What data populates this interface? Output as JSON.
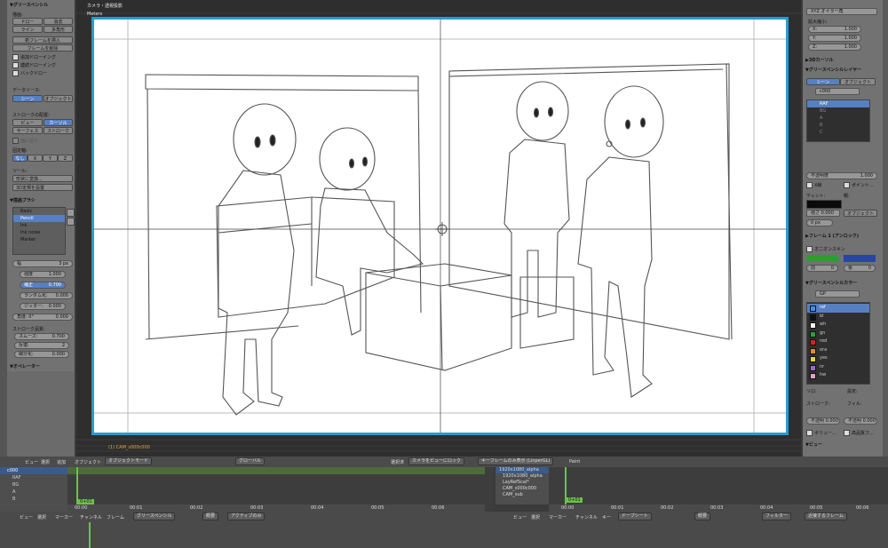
{
  "left_panel": {
    "title": "▼グリースペンシル",
    "draw_label": "描画:",
    "draw_buttons": [
      "ドロー",
      "消去",
      "ライン",
      "多角形"
    ],
    "actions": [
      "新フレームを挿入",
      "フレームを削除"
    ],
    "checks": [
      "追加ドローイング",
      "連続ドローイング",
      "バックドロー"
    ],
    "datasource_label": "データソース:",
    "datasource_buttons": [
      "シーン",
      "オブジェクト"
    ],
    "stroke_placement_label": "ストロークの配置:",
    "placement_buttons": [
      "ビュー",
      "カーソル",
      "サーフェス",
      "ストローク"
    ],
    "plane_label": "面に沿う",
    "lock_axis_label": "固定軸:",
    "axis_buttons": [
      "なし",
      "X",
      "Y",
      "Z"
    ],
    "tools_label": "ツール:",
    "tools_buttons": [
      "形状に変換...",
      "3D定規を設置"
    ],
    "brush_title": "▼描画ブラシ",
    "brushes": [
      "Basic",
      "Pencil",
      "Ink",
      "Ink noise",
      "Marker"
    ],
    "width_label": "幅",
    "width_value": "3 px",
    "fields": [
      {
        "label": "強度",
        "value": "1.000"
      },
      {
        "label": "補正",
        "value": "0.700"
      },
      {
        "label": "ランダム化:",
        "value": "0.000"
      },
      {
        "label": "ジッター:",
        "value": "0.000"
      },
      {
        "label": "角度: 0°",
        "value": "0.000"
      }
    ],
    "stroke_qual_label": "ストローク品質:",
    "smooth_label": "スムーズ:",
    "smooth_value": "0.700",
    "iter_label": "反復:",
    "iter_value": "2",
    "subdiv_label": "細分化:",
    "subdiv_value": "0.000",
    "operator_label": "▼オペレーター"
  },
  "viewport": {
    "title": "カメラ・透視投影",
    "subtitle": "Meters",
    "camera_name": "(1) CAM_s000c000"
  },
  "right_panel": {
    "rotation_mode": "XYZ オイラー角",
    "scale_label": "拡大縮小:",
    "scale_values": [
      {
        "label": "X:",
        "value": "1.000"
      },
      {
        "label": "Y:",
        "value": "1.000"
      },
      {
        "label": "Z:",
        "value": "1.000"
      }
    ],
    "cursor_label": "▶3Dカーソル",
    "layer_title": "▼グリースペンシルレイヤー",
    "layer_tabs": [
      "シーン",
      "オブジェクト"
    ],
    "layer_name": "c000",
    "layers": [
      "RAF",
      "BG",
      "A",
      "B",
      "C"
    ],
    "opacity_label": "不透明度",
    "opacity_value": "1.000",
    "xray_label": "X線",
    "points_label": "ポイント...",
    "tint_label": "ティント:",
    "parent_label": "親:",
    "tint_value": "強さ 0.000",
    "object_label": "オブジェクト",
    "thickness": "0 px",
    "frame_label": "▶フレーム 1 (アンロック)",
    "onion_label": "オニオンスキン",
    "before_label": "前",
    "before_value": "0",
    "after_label": "後",
    "after_value": "0",
    "color_title": "▼グリースペンシルカラー",
    "palette_name": "GP",
    "colors": [
      {
        "name": "ref",
        "color": "#4a8fd8"
      },
      {
        "name": "bl",
        "color": "#111111"
      },
      {
        "name": "wh",
        "color": "#ffffff"
      },
      {
        "name": "gn",
        "color": "#2e9c35"
      },
      {
        "name": "red",
        "color": "#d22222"
      },
      {
        "name": "ora",
        "color": "#e08a2a"
      },
      {
        "name": "yes",
        "color": "#e0d43a"
      },
      {
        "name": "nr",
        "color": "#9a6ac4"
      },
      {
        "name": "hw",
        "color": "#e9a0c4"
      }
    ],
    "solo_label": "ソロ:",
    "settings_label": "設定:",
    "stroke_label": "ストローク:",
    "fill_label": "フィル:",
    "stroke_opacity": "不透明 0.000",
    "fill_opacity": "不透明 0.000",
    "volume_label": "ボリュー...",
    "hq_label": "高品質フ...",
    "view_label": "▼ビュー"
  },
  "viewport_header": {
    "menus": [
      "ビュー",
      "選択",
      "追加",
      "オブジェクト"
    ],
    "mode": "オブジェクトモード",
    "orientation": "グローバル",
    "selected_label": "選択済",
    "lock_camera": "カメラをビューにロック",
    "keyframe": "キーフレームのみ表示 (LinperGL)",
    "paint": "Paint"
  },
  "dopesheet": {
    "root": "c000",
    "rows": [
      "RAF",
      "BG",
      "A",
      "B",
      "C"
    ],
    "ticks": [
      "00:00",
      "00:01",
      "00:02",
      "00:03",
      "00:04",
      "00:05",
      "00:06"
    ],
    "frame_indicator": "0+01",
    "menus": [
      "ビュー",
      "選択",
      "マーカー",
      "チャンネル",
      "フレーム"
    ],
    "mode": "グリースペンシル",
    "summary": "概要",
    "active_only": "アクティブのみ"
  },
  "outliner": {
    "items": [
      "1920x1080_alpha",
      "1920x1080_alpha",
      "LayRefScal*",
      "CAM_s000c000",
      "CAM_sub"
    ]
  },
  "timeline": {
    "frame_indicator": "0+01",
    "menus": [
      "ビュー",
      "選択",
      "マーカー",
      "チャンネル",
      "キー"
    ],
    "keying": "ドープシート",
    "summary": "概要",
    "filter": "フィルター",
    "nearest": "近接するフレーム",
    "ticks": [
      "00:00",
      "00:01",
      "00:02",
      "00:03",
      "00:04",
      "00:05",
      "00:06"
    ]
  }
}
